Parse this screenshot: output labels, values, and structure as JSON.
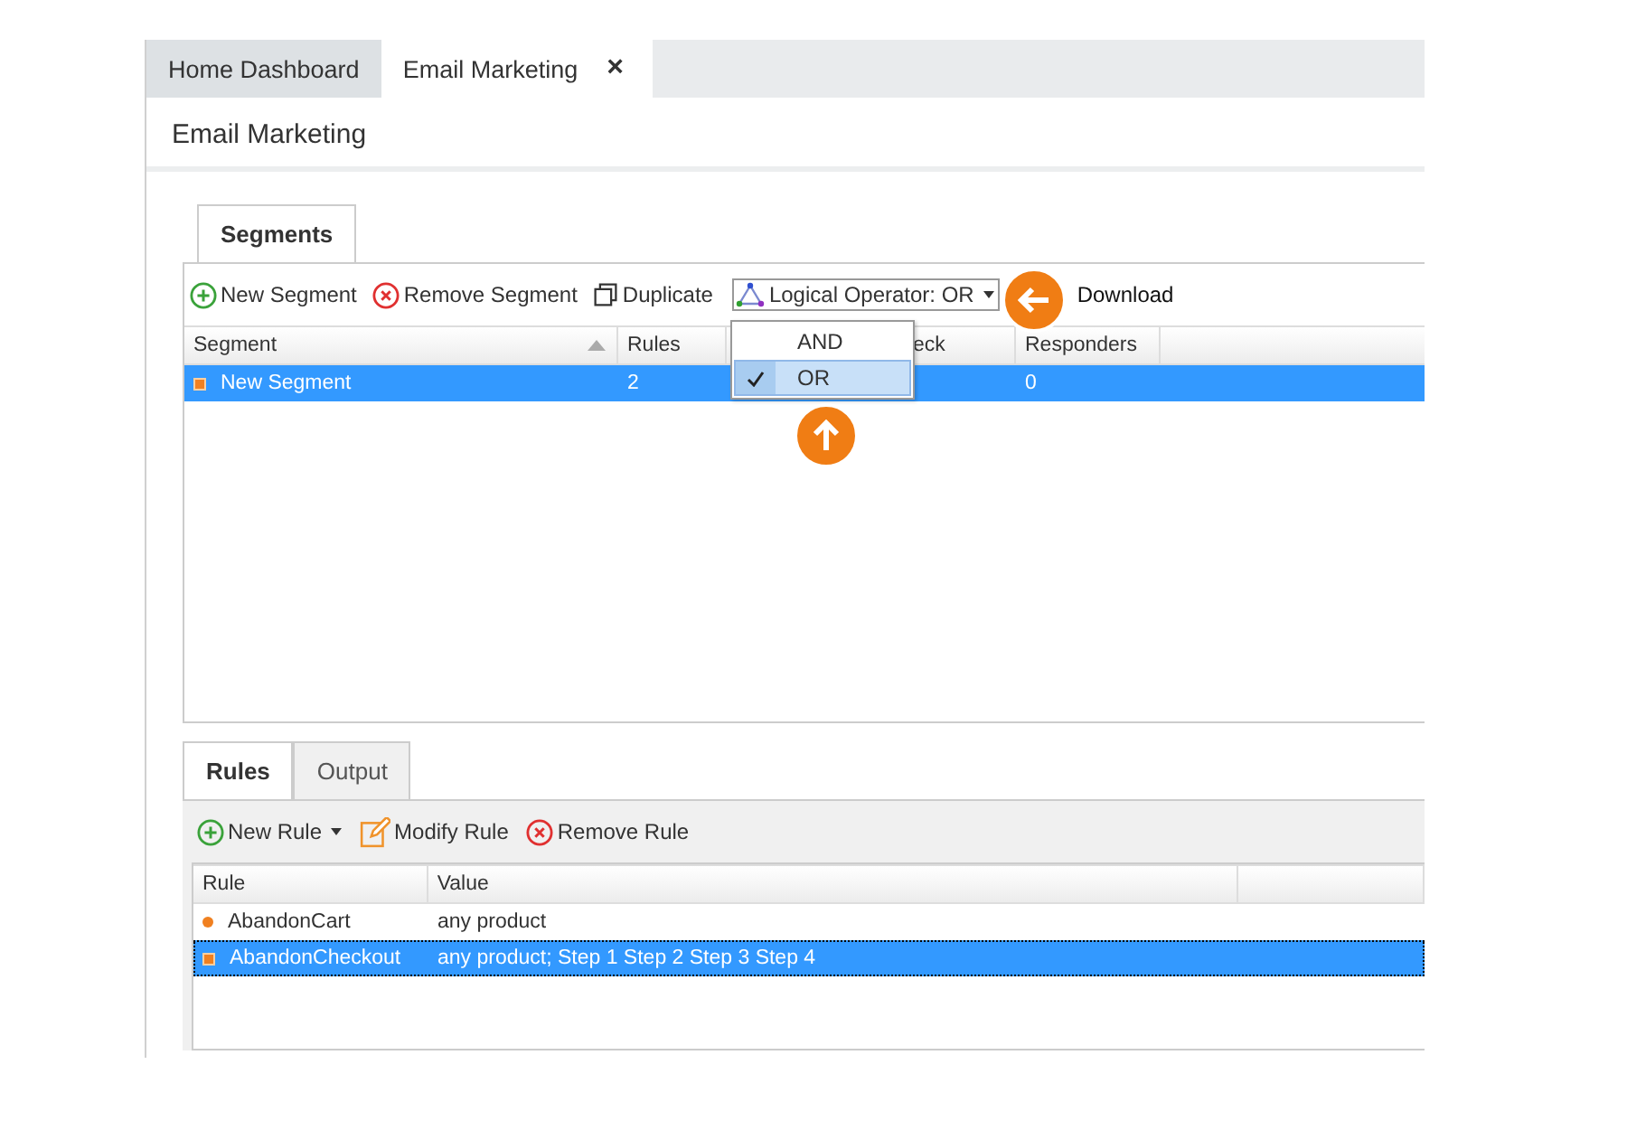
{
  "tabs": [
    {
      "label": "Home Dashboard",
      "selected": false,
      "closable": false
    },
    {
      "label": "Email Marketing",
      "selected": true,
      "closable": true,
      "close": "×"
    }
  ],
  "page_title": "Email Marketing",
  "segments": {
    "tabs": [
      {
        "label": "Segments",
        "selected": true
      }
    ],
    "toolbar": [
      {
        "kind": "add",
        "label": "New Segment"
      },
      {
        "kind": "remove",
        "label": "Remove Segment"
      },
      {
        "kind": "copy",
        "label": "Duplicate"
      },
      {
        "kind": "operator",
        "label": "Logical Operator: OR"
      },
      {
        "kind": "plain",
        "label": "Download"
      }
    ],
    "operator_menu": [
      {
        "label": "AND",
        "selected": false
      },
      {
        "label": "OR",
        "selected": true
      }
    ],
    "columns": [
      "Segment",
      "Rules",
      "",
      "eck",
      "Responders"
    ],
    "rows": [
      {
        "selected": true,
        "cells": [
          "New Segment",
          "2",
          "",
          "",
          "0"
        ]
      }
    ]
  },
  "rules": {
    "tabs": [
      {
        "label": "Rules",
        "selected": true
      },
      {
        "label": "Output",
        "selected": false
      }
    ],
    "toolbar": [
      {
        "kind": "add",
        "label": "New Rule",
        "dropdown": true
      },
      {
        "kind": "edit",
        "label": "Modify Rule",
        "dropdown": false
      },
      {
        "kind": "remove",
        "label": "Remove Rule",
        "dropdown": false
      }
    ],
    "columns": [
      "Rule",
      "Value",
      ""
    ],
    "rows": [
      {
        "kind": "dot",
        "selected": false,
        "cells": [
          "AbandonCart",
          "any product"
        ]
      },
      {
        "kind": "square",
        "selected": true,
        "cells": [
          "AbandonCheckout",
          "any product; Step 1 Step 2 Step 3 Step 4"
        ]
      }
    ]
  }
}
